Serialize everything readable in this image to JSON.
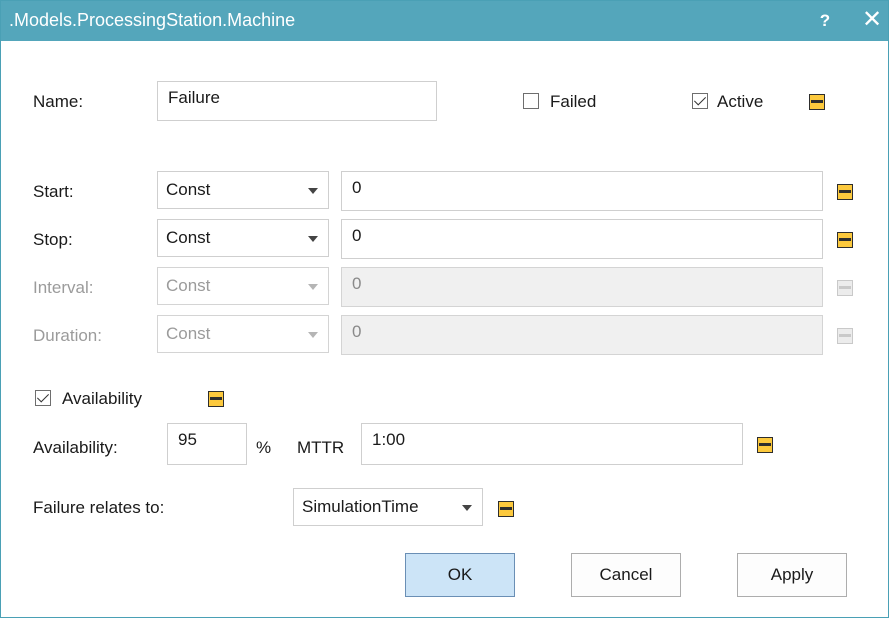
{
  "window": {
    "title": ".Models.ProcessingStation.Machine",
    "help_label": "?",
    "close_label": "✕"
  },
  "name_row": {
    "label": "Name:",
    "value": "Failure",
    "failed_label": "Failed",
    "failed_checked": false,
    "active_label": "Active",
    "active_checked": true
  },
  "timing": [
    {
      "label": "Start:",
      "dist": "Const",
      "value": "0",
      "enabled": true
    },
    {
      "label": "Stop:",
      "dist": "Const",
      "value": "0",
      "enabled": true
    },
    {
      "label": "Interval:",
      "dist": "Const",
      "value": "0",
      "enabled": false
    },
    {
      "label": "Duration:",
      "dist": "Const",
      "value": "0",
      "enabled": false
    }
  ],
  "availability": {
    "checkbox_label": "Availability",
    "checked": true,
    "label": "Availability:",
    "value": "95",
    "unit": "%",
    "mttr_label": "MTTR",
    "mttr_value": "1:00"
  },
  "relates": {
    "label": "Failure relates to:",
    "value": "SimulationTime"
  },
  "buttons": {
    "ok": "OK",
    "cancel": "Cancel",
    "apply": "Apply"
  },
  "colors": {
    "titlebar": "#54a6bb",
    "inherit_button": "#fcc93d",
    "default_button": "#cce4f7"
  }
}
